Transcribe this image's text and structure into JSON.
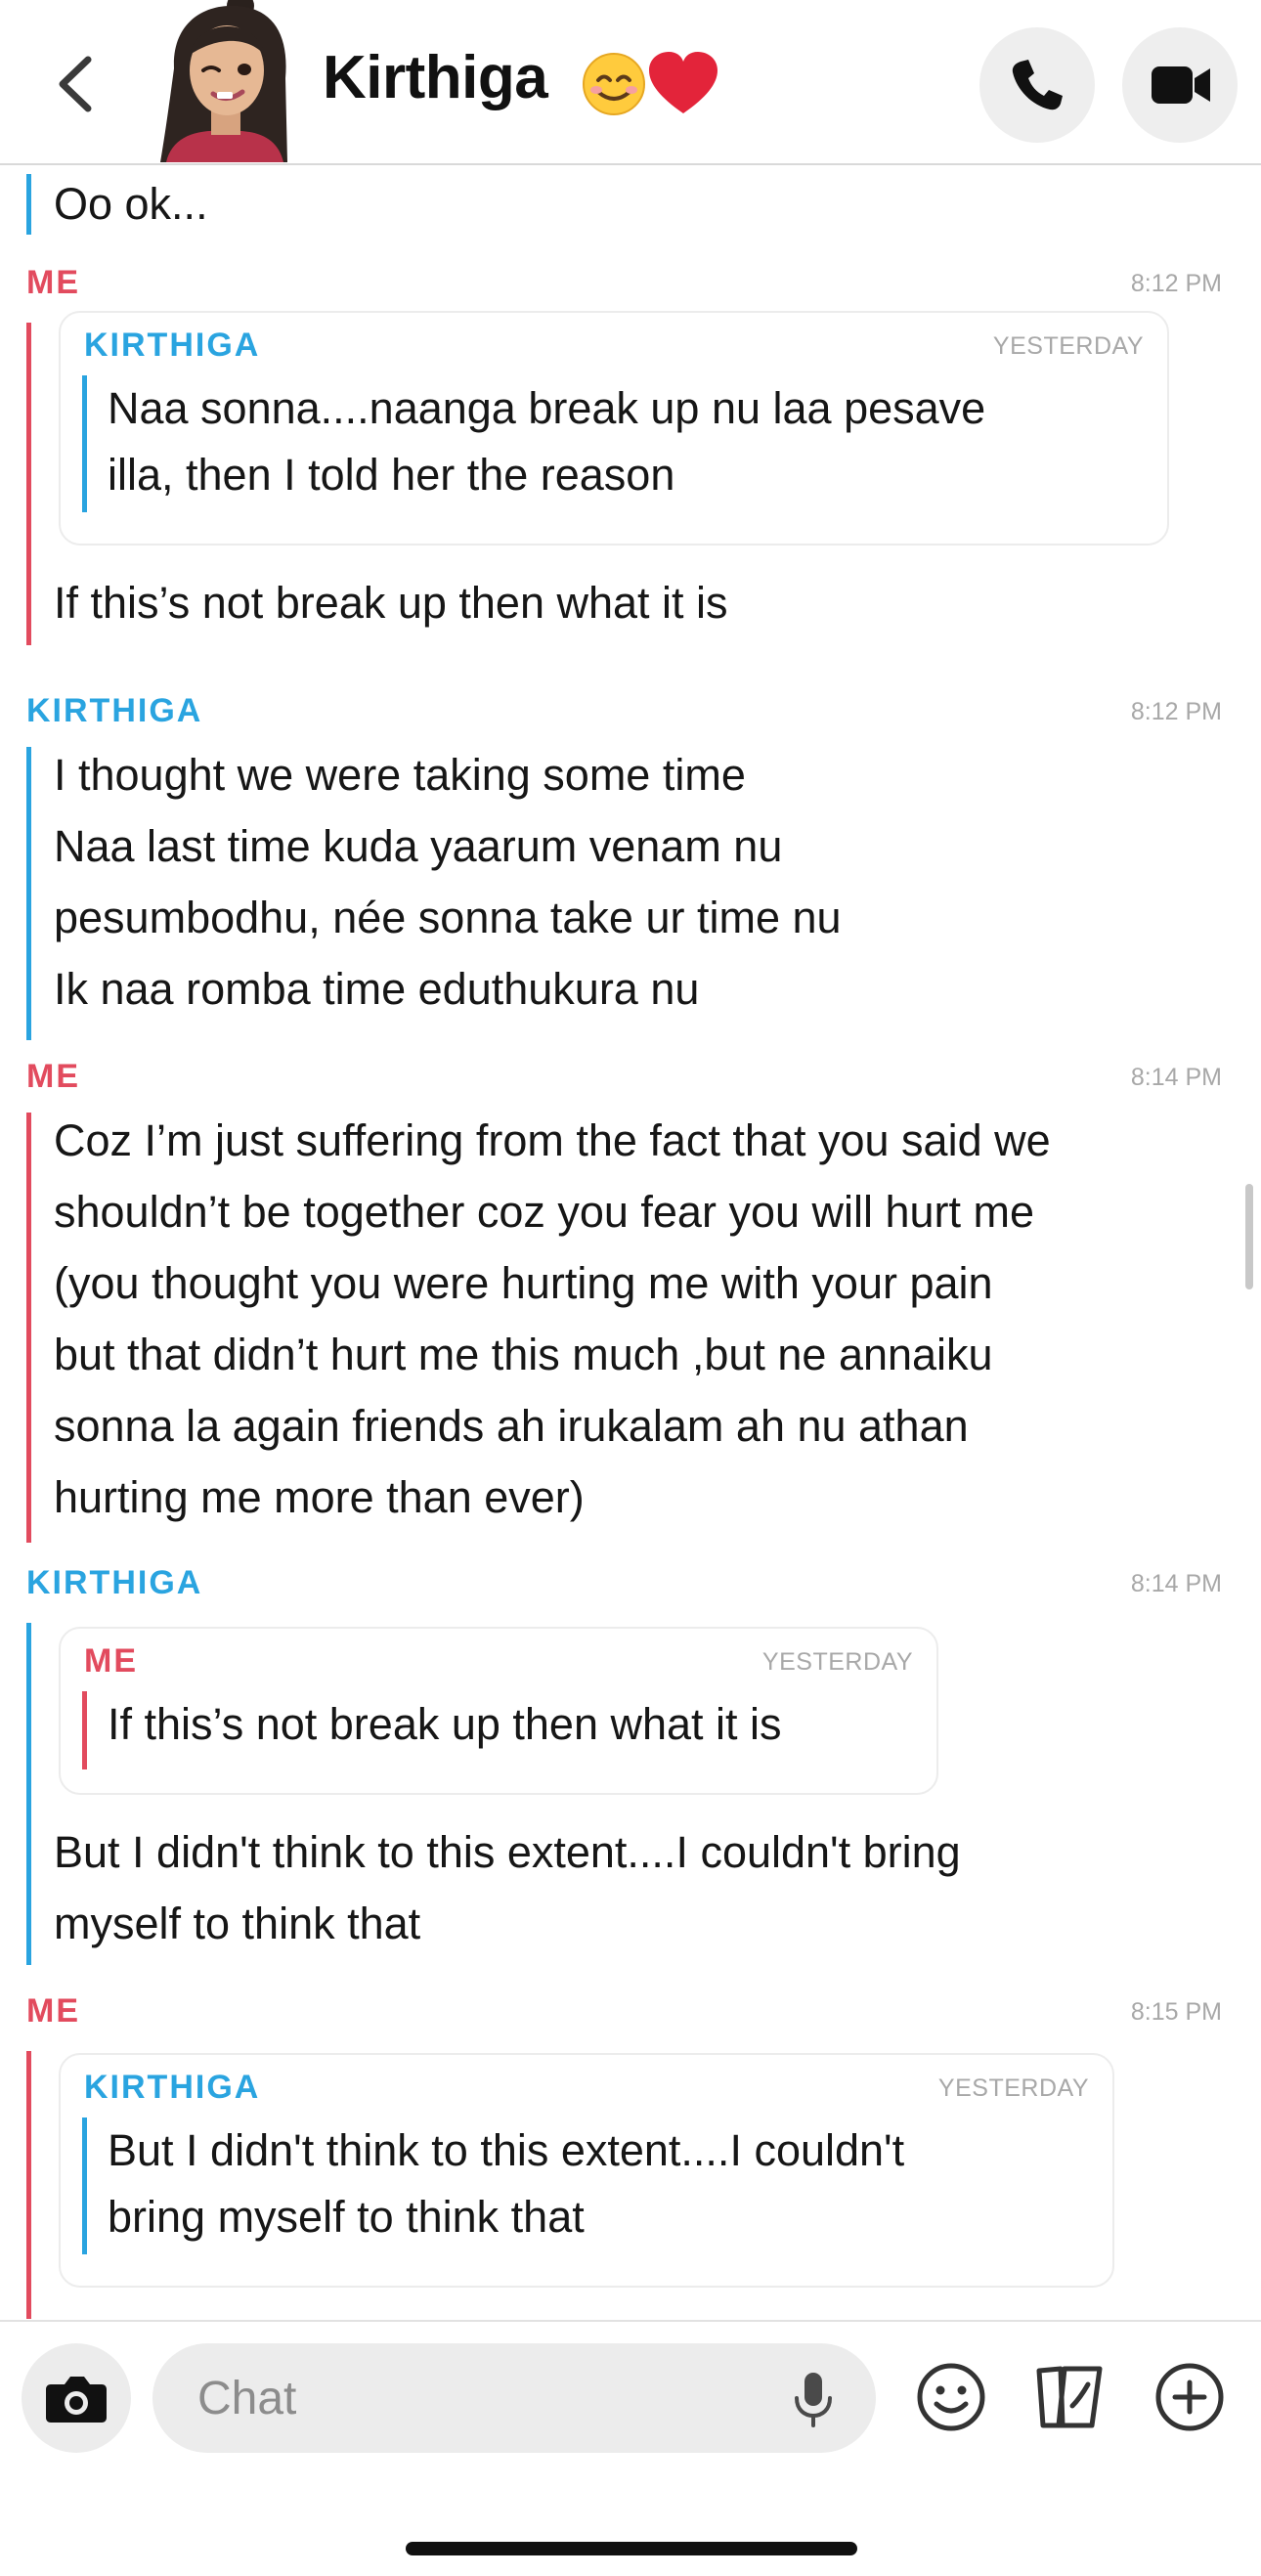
{
  "header": {
    "contact_name": "Kirthiga",
    "name_emojis": "😊❤️",
    "icons": {
      "back": "chevron-left-icon",
      "call": "phone-icon",
      "video": "video-camera-icon"
    }
  },
  "chat": {
    "partial_message": "Oo ok...",
    "blocks": [
      {
        "sender": "ME",
        "time": "8:12 PM",
        "quote": {
          "sender": "KIRTHIGA",
          "time": "YESTERDAY",
          "text": "Naa sonna....naanga break up nu laa pesave\nilla, then I told her the reason"
        },
        "message": "If this’s not break up then what it is"
      },
      {
        "sender": "KIRTHIGA",
        "time": "8:12 PM",
        "message": "I thought we were taking some time\nNaa last time kuda yaarum venam nu\npesumbodhu, née sonna take ur time nu\nIk naa romba time eduthukura nu"
      },
      {
        "sender": "ME",
        "time": "8:14 PM",
        "message": "Coz I’m just suffering from the fact that you said we\nshouldn’t be together coz you fear you will hurt me\n(you thought you were hurting me with your pain\nbut that didn’t hurt me this much ,but ne annaiku\nsonna la again friends ah irukalam ah nu athan\nhurting me more than ever)"
      },
      {
        "sender": "KIRTHIGA",
        "time": "8:14 PM",
        "quote": {
          "sender": "ME",
          "time": "YESTERDAY",
          "text": "If this’s not break up then what it is"
        },
        "message": "But I didn't think to this extent....I couldn't bring\nmyself to think that"
      },
      {
        "sender": "ME",
        "time": "8:15 PM",
        "quote": {
          "sender": "KIRTHIGA",
          "time": "YESTERDAY",
          "text": "But I didn't think to this extent....I couldn't\nbring myself to think that"
        }
      }
    ]
  },
  "composer": {
    "placeholder": "Chat",
    "icons": {
      "camera": "camera-icon",
      "mic": "microphone-icon",
      "emoji": "smiley-icon",
      "cards": "cards-icon",
      "plus": "plus-circle-icon"
    }
  },
  "colors": {
    "me": "#e24b5e",
    "kirthiga": "#2aa4e0",
    "timestamp": "#a8a8a8",
    "button_bg": "#eeeeee"
  }
}
